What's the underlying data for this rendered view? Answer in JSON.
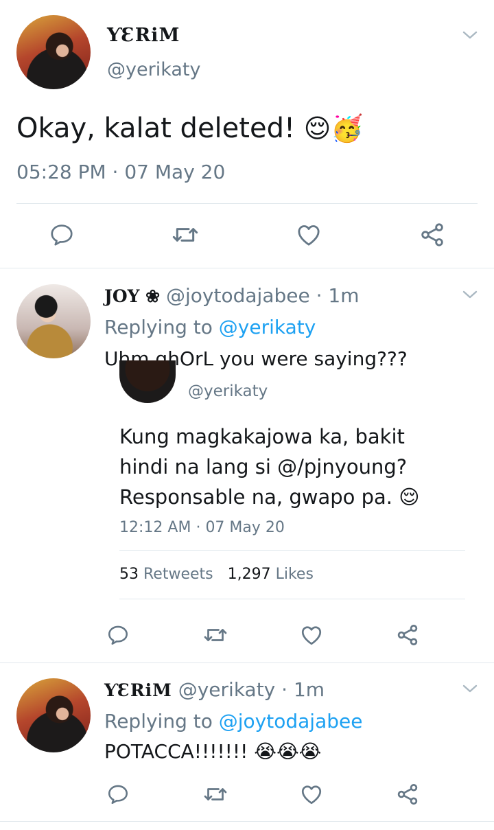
{
  "main_tweet": {
    "display_name": "ƳƐRiM",
    "handle": "@yerikaty",
    "text": "Okay, kalat deleted!",
    "emojis": "😌🥳",
    "time": "05:28 PM",
    "sep": "·",
    "date": "07 May 20"
  },
  "reply_joy": {
    "display_name": "JOY ❀",
    "handle": "@joytodajabee",
    "age": "· 1m",
    "replying_prefix": "Replying to",
    "replying_to": "@yerikaty",
    "text": "Uhm ghOrL you were saying???",
    "quoted": {
      "handle": "@yerikaty",
      "line1": "Kung magkakajowa ka, bakit",
      "line2": "hindi na lang si @/pjnyoung?",
      "line3": "Responsable na, gwapo pa.",
      "emoji": "😌",
      "time": "12:12 AM",
      "sep": "·",
      "date": "07 May 20",
      "retweets_count": "53",
      "retweets_label": "Retweets",
      "likes_count": "1,297",
      "likes_label": "Likes"
    }
  },
  "reply_yeri": {
    "display_name": "ƳƐRiM",
    "handle": "@yerikaty",
    "age": "· 1m",
    "replying_prefix": "Replying to",
    "replying_to": "@joytodajabee",
    "text": "POTACCA!!!!!!!",
    "emojis": "😭😭😭"
  },
  "icons": {
    "reply": "reply-icon",
    "retweet": "retweet-icon",
    "like": "heart-icon",
    "share": "share-icon",
    "menu": "chevron-down-icon"
  },
  "colors": {
    "text": "#14171a",
    "muted": "#657786",
    "link": "#1da1f2",
    "divider": "#e1e8ed"
  }
}
